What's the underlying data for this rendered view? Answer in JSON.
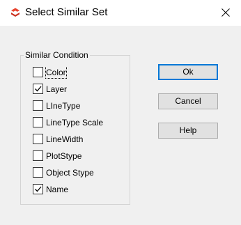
{
  "window": {
    "title": "Select Similar Set",
    "icon": "app-logo-icon",
    "close_icon": "close-icon"
  },
  "group": {
    "legend": "Similar Condition",
    "items": [
      {
        "label": "Color",
        "checked": false
      },
      {
        "label": "Layer",
        "checked": true
      },
      {
        "label": "LIneType",
        "checked": false
      },
      {
        "label": "LineType Scale",
        "checked": false
      },
      {
        "label": "LineWidth",
        "checked": false
      },
      {
        "label": "PlotStype",
        "checked": false
      },
      {
        "label": "Object Stype",
        "checked": false
      },
      {
        "label": "Name",
        "checked": true
      }
    ]
  },
  "buttons": {
    "ok": "Ok",
    "cancel": "Cancel",
    "help": "Help"
  },
  "colors": {
    "accent": "#0078d7",
    "icon_red": "#e8432e",
    "background": "#f0f0f0"
  }
}
